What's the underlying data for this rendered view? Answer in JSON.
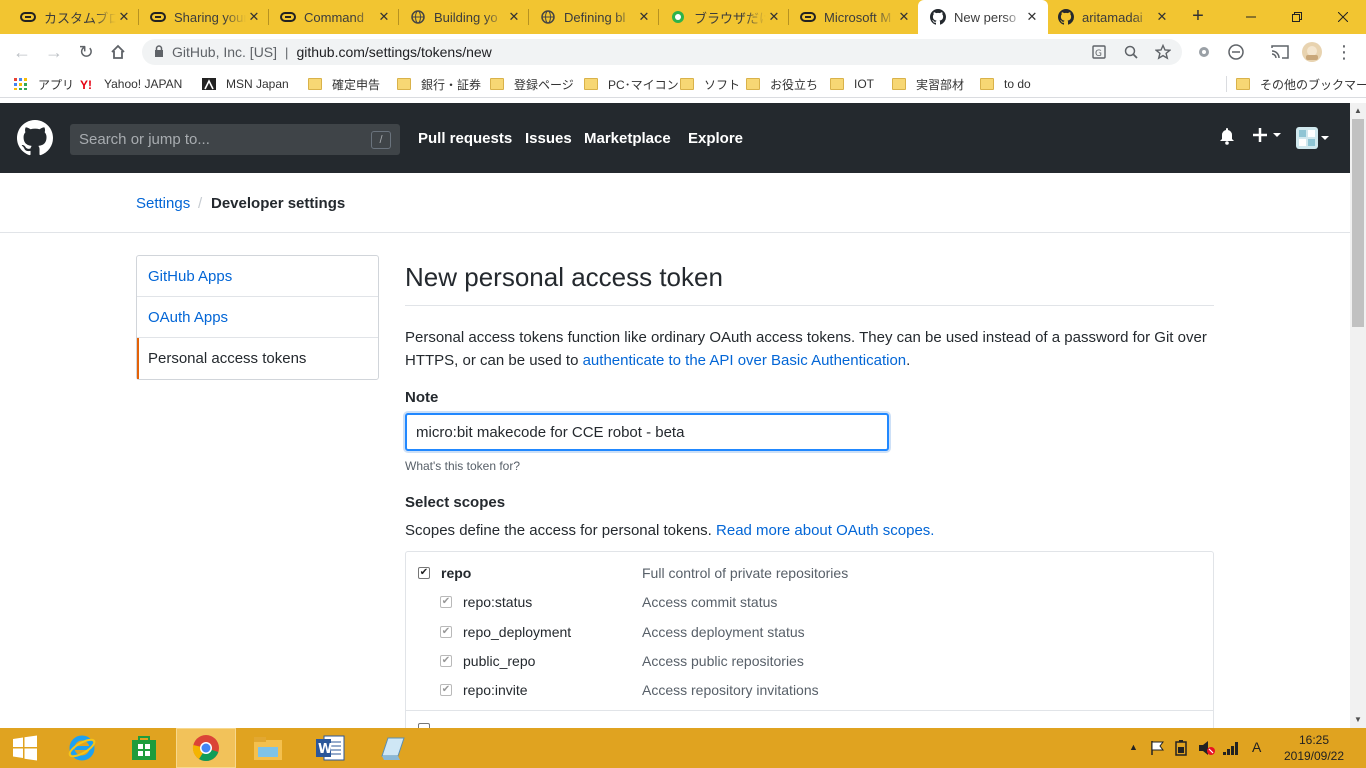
{
  "browser": {
    "tabs": [
      {
        "label": "カスタムブロッ",
        "icon": "link-icon"
      },
      {
        "label": "Sharing your",
        "icon": "link-icon"
      },
      {
        "label": "Command",
        "icon": "link-icon"
      },
      {
        "label": "Building yo",
        "icon": "globe-icon"
      },
      {
        "label": "Defining bl",
        "icon": "globe-icon"
      },
      {
        "label": "ブラウザだけで",
        "icon": "green-q-icon"
      },
      {
        "label": "Microsoft M",
        "icon": "link-icon"
      },
      {
        "label": "New perso",
        "icon": "github-icon",
        "active": true
      },
      {
        "label": "aritamadai",
        "icon": "github-icon"
      }
    ],
    "close_glyph": "✕",
    "new_tab_glyph": "+",
    "address": {
      "org": "GitHub, Inc. [US]",
      "url": "github.com/settings/tokens/new"
    },
    "bookmarks": [
      {
        "label": "アプリ",
        "icon": "apps-grid-icon"
      },
      {
        "label": "Yahoo! JAPAN",
        "icon": "yahoo-icon"
      },
      {
        "label": "MSN Japan",
        "icon": "msn-icon"
      },
      {
        "label": "確定申告",
        "icon": "folder-icon"
      },
      {
        "label": "銀行・証券",
        "icon": "folder-icon"
      },
      {
        "label": "登録ページ",
        "icon": "folder-icon"
      },
      {
        "label": "PC･マイコン",
        "icon": "folder-icon"
      },
      {
        "label": "ソフト",
        "icon": "folder-icon"
      },
      {
        "label": "お役立ち",
        "icon": "folder-icon"
      },
      {
        "label": "IOT",
        "icon": "folder-icon"
      },
      {
        "label": "実習部材",
        "icon": "folder-icon"
      },
      {
        "label": "to do",
        "icon": "folder-icon"
      }
    ],
    "other_bookmarks": "その他のブックマーク"
  },
  "github": {
    "search_placeholder": "Search or jump to...",
    "search_shortcut": "/",
    "nav": [
      "Pull requests",
      "Issues",
      "Marketplace",
      "Explore"
    ],
    "breadcrumb": {
      "parent": "Settings",
      "separator": "/",
      "current": "Developer settings"
    },
    "menu": [
      {
        "label": "GitHub Apps"
      },
      {
        "label": "OAuth Apps"
      },
      {
        "label": "Personal access tokens",
        "selected": true
      }
    ],
    "page_title": "New personal access token",
    "description_prefix": "Personal access tokens function like ordinary OAuth access tokens. They can be used instead of a password for Git over HTTPS, or can be used to ",
    "description_link": "authenticate to the API over Basic Authentication",
    "description_suffix": ".",
    "note_label": "Note",
    "note_value": "micro:bit makecode for CCE robot - beta",
    "note_hint": "What's this token for?",
    "scopes_title": "Select scopes",
    "scopes_desc_prefix": "Scopes define the access for personal tokens. ",
    "scopes_desc_link": "Read more about OAuth scopes.",
    "scopes": [
      {
        "name": "repo",
        "desc": "Full control of private repositories",
        "checked": true,
        "parent": true
      },
      {
        "name": "repo:status",
        "desc": "Access commit status",
        "checked": true
      },
      {
        "name": "repo_deployment",
        "desc": "Access deployment status",
        "checked": true
      },
      {
        "name": "public_repo",
        "desc": "Access public repositories",
        "checked": true
      },
      {
        "name": "repo:invite",
        "desc": "Access repository invitations",
        "checked": true
      }
    ]
  },
  "taskbar": {
    "ime": "A",
    "time": "16:25",
    "date": "2019/09/22"
  },
  "colors": {
    "tabstrip": "#f2c531",
    "github_header": "#24292e",
    "link": "#0366d6",
    "menu_selected_accent": "#e36209",
    "taskbar": "#e0a320"
  }
}
